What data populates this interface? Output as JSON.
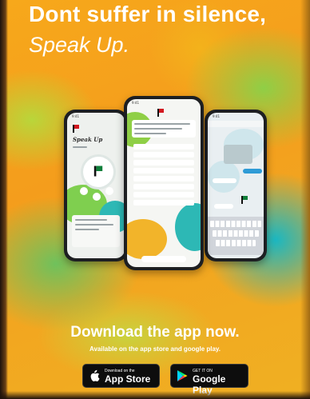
{
  "headline": {
    "line1": "Dont suffer in silence,",
    "line2": "Speak Up."
  },
  "cta": {
    "title": "Download the app now.",
    "subtitle": "Available on the app store and google play."
  },
  "stores": {
    "apple": {
      "small": "Download on the",
      "big": "App Store",
      "icon": "apple-icon"
    },
    "google": {
      "small": "GET IT ON",
      "big": "Google Play",
      "icon": "google-play-icon"
    }
  },
  "phone_left": {
    "brand": "Speak Up"
  },
  "colors": {
    "background_orange": "#f49d1c",
    "accent_green": "#6fc15c",
    "accent_teal": "#1bb7c1",
    "flag_red": "#d3191f",
    "text_white": "#ffffff"
  }
}
